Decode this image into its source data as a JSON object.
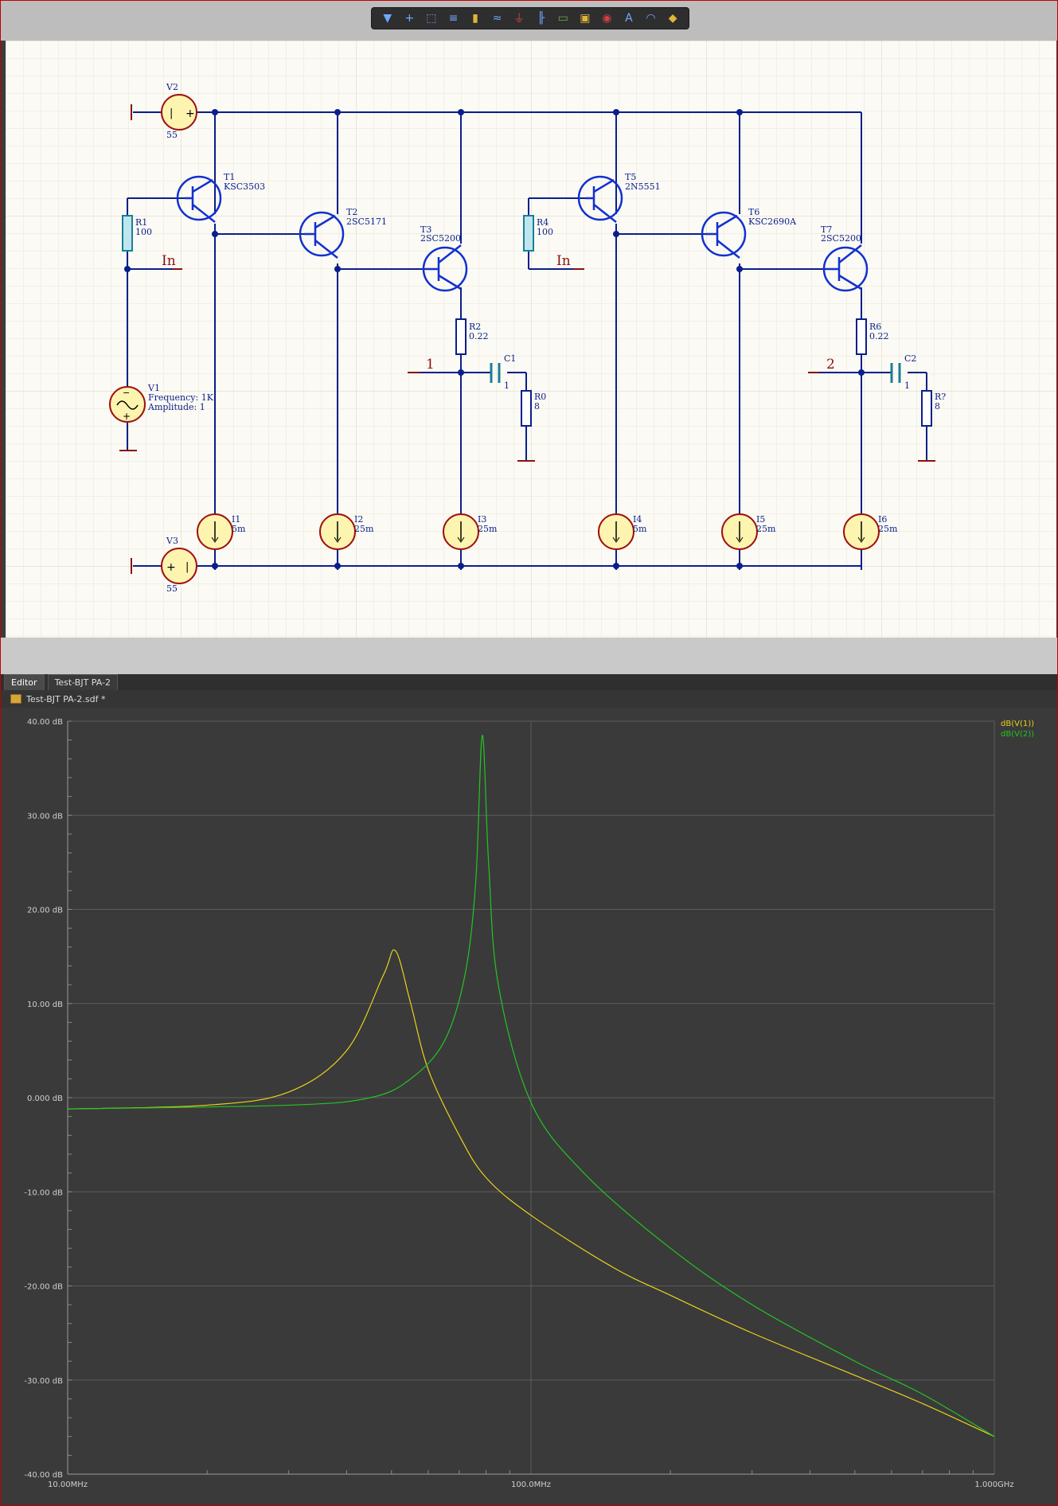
{
  "toolbar": {
    "tools": [
      "filter-icon",
      "cross-probe-icon",
      "select-rect-icon",
      "align-icon",
      "place-part-icon",
      "wire-icon",
      "ground-icon",
      "bus-icon",
      "port-icon",
      "net-label-icon",
      "probe-icon",
      "text-icon",
      "arc-icon",
      "highlight-icon"
    ]
  },
  "schematic": {
    "v2": {
      "name": "V2",
      "value": "55"
    },
    "v3": {
      "name": "V3",
      "value": "55"
    },
    "v1": {
      "name": "V1",
      "freq": "Frequency: 1K",
      "amp": "Amplitude: 1"
    },
    "t1": {
      "name": "T1",
      "part": "KSC3503"
    },
    "t2": {
      "name": "T2",
      "part": "2SC5171"
    },
    "t3": {
      "name": "T3",
      "part": "2SC5200"
    },
    "t5": {
      "name": "T5",
      "part": "2N5551"
    },
    "t6": {
      "name": "T6",
      "part": "KSC2690A"
    },
    "t7": {
      "name": "T7",
      "part": "2SC5200"
    },
    "r1": {
      "name": "R1",
      "value": "100"
    },
    "r4": {
      "name": "R4",
      "value": "100"
    },
    "r2": {
      "name": "R2",
      "value": "0.22"
    },
    "r6": {
      "name": "R6",
      "value": "0.22"
    },
    "r0": {
      "name": "R0",
      "value": "8"
    },
    "r7": {
      "name": "R?",
      "value": "8"
    },
    "c1": {
      "name": "C1",
      "value": "1"
    },
    "c2": {
      "name": "C2",
      "value": "1"
    },
    "in_label": "In",
    "net1": "1",
    "net2": "2",
    "sources": [
      {
        "name": "I1",
        "value": "5m"
      },
      {
        "name": "I2",
        "value": "25m"
      },
      {
        "name": "I3",
        "value": "25m"
      },
      {
        "name": "I4",
        "value": "5m"
      },
      {
        "name": "I5",
        "value": "25m"
      },
      {
        "name": "I6",
        "value": "25m"
      }
    ]
  },
  "tabs": {
    "editor": "Editor",
    "doc": "Test-BJT PA-2"
  },
  "docbar": {
    "title": "Test-BJT PA-2.sdf *"
  },
  "chart_data": {
    "type": "line",
    "x_scale": "log",
    "xlim": [
      10000000,
      1000000000
    ],
    "ylim": [
      -40,
      40
    ],
    "x_ticks": [
      "10.00MHz",
      "100.0MHz",
      "1.000GHz"
    ],
    "y_ticks": [
      "40.00 dB",
      "30.00 dB",
      "20.00 dB",
      "10.00 dB",
      "0.000 dB",
      "-10.00 dB",
      "-20.00 dB",
      "-30.00 dB",
      "-40.00 dB"
    ],
    "grid": true,
    "legend_position": "top-right",
    "series": [
      {
        "name": "dB(V(1))",
        "color": "#e8d21a",
        "points": [
          [
            10000000,
            -1.2
          ],
          [
            20000000,
            -0.8
          ],
          [
            30000000,
            0.6
          ],
          [
            40000000,
            5
          ],
          [
            48000000,
            13
          ],
          [
            51000000,
            15.6
          ],
          [
            55000000,
            10
          ],
          [
            60000000,
            3
          ],
          [
            70000000,
            -4
          ],
          [
            80000000,
            -8.5
          ],
          [
            100000000,
            -12.5
          ],
          [
            150000000,
            -18
          ],
          [
            200000000,
            -21
          ],
          [
            300000000,
            -25
          ],
          [
            500000000,
            -29.5
          ],
          [
            700000000,
            -32.5
          ],
          [
            1000000000,
            -36
          ]
        ]
      },
      {
        "name": "dB(V(2))",
        "color": "#23c423",
        "points": [
          [
            10000000,
            -1.2
          ],
          [
            30000000,
            -0.8
          ],
          [
            45000000,
            0
          ],
          [
            55000000,
            2
          ],
          [
            65000000,
            6
          ],
          [
            72000000,
            13
          ],
          [
            76000000,
            23
          ],
          [
            78500000,
            38.5
          ],
          [
            81000000,
            25
          ],
          [
            85000000,
            12
          ],
          [
            100000000,
            -0.5
          ],
          [
            130000000,
            -8
          ],
          [
            200000000,
            -16
          ],
          [
            300000000,
            -22
          ],
          [
            500000000,
            -28
          ],
          [
            700000000,
            -31.5
          ],
          [
            1000000000,
            -36
          ]
        ]
      }
    ]
  }
}
